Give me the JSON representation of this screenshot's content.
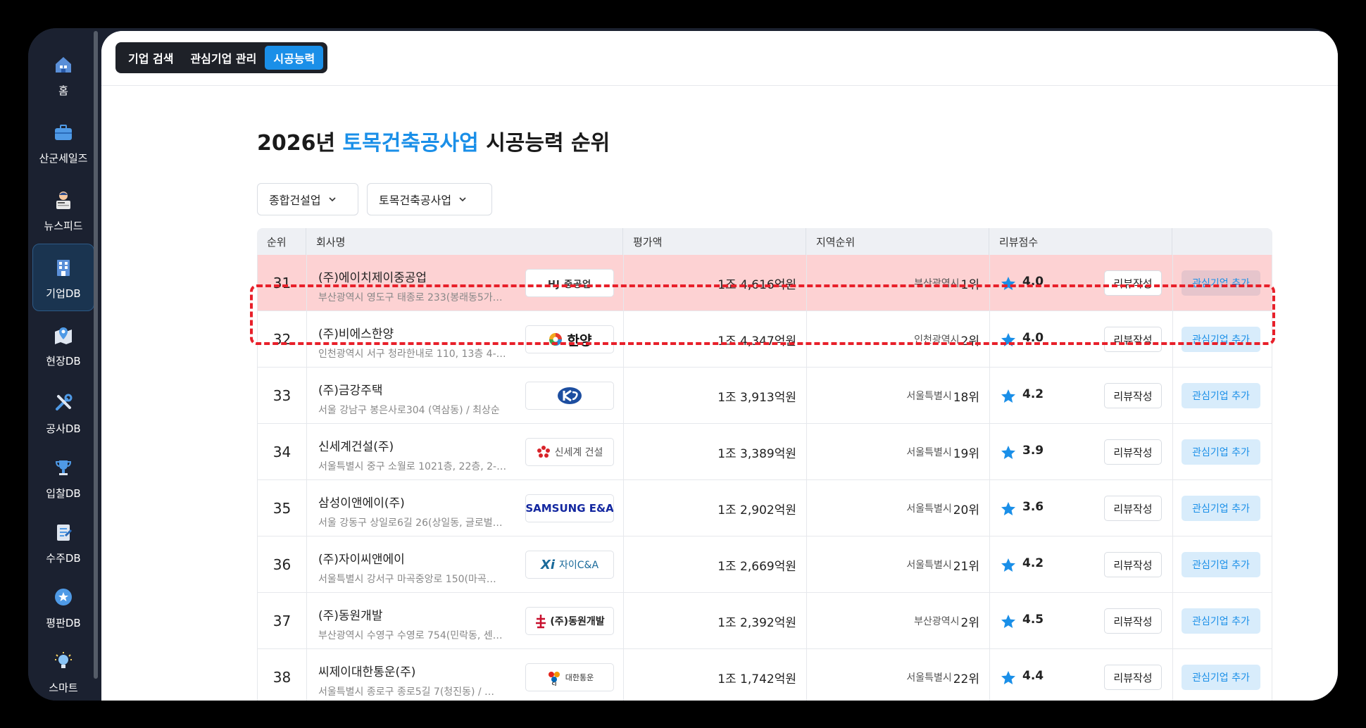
{
  "sidebar": {
    "items": [
      {
        "label": "홈",
        "icon": "home-icon"
      },
      {
        "label": "산군세일즈",
        "icon": "briefcase-icon"
      },
      {
        "label": "뉴스피드",
        "icon": "newspaper-reader-icon"
      },
      {
        "label": "기업DB",
        "icon": "building-icon"
      },
      {
        "label": "현장DB",
        "icon": "map-pin-icon"
      },
      {
        "label": "공사DB",
        "icon": "tools-icon"
      },
      {
        "label": "입찰DB",
        "icon": "trophy-icon"
      },
      {
        "label": "수주DB",
        "icon": "clipboard-icon"
      },
      {
        "label": "평판DB",
        "icon": "star-badge-icon"
      },
      {
        "label": "스마트",
        "icon": "lightbulb-icon"
      }
    ],
    "active_label": "기업DB"
  },
  "tabs": [
    {
      "label": "기업 검색"
    },
    {
      "label": "관심기업 관리"
    },
    {
      "label": "시공능력"
    }
  ],
  "page": {
    "title_prefix": "2026년 ",
    "title_highlight": "토목건축공사업",
    "title_suffix": " 시공능력 순위"
  },
  "filters": {
    "industry": "종합건설업",
    "category": "토목건축공사업"
  },
  "table": {
    "headers": [
      "순위",
      "회사명",
      "평가액",
      "지역순위",
      "리뷰점수",
      ""
    ],
    "review_button": "리뷰작성",
    "favorite_button": "관심기업 추가",
    "rows": [
      {
        "rank": "31",
        "name": "(주)에이치제이중공업",
        "address": "부산광역시 영도구 태종로 233(봉래동5가…",
        "logo": "HJ 중공업",
        "amount": "1조 4,616억원",
        "region": "부산광역시",
        "region_rank": "1위",
        "score": "4.0",
        "highlighted": true
      },
      {
        "rank": "32",
        "name": "(주)비에스한양",
        "address": "인천광역시 서구 청라한내로 110, 13층 4-…",
        "logo": "한양",
        "amount": "1조 4,347억원",
        "region": "인천광역시",
        "region_rank": "2위",
        "score": "4.0",
        "highlighted": false
      },
      {
        "rank": "33",
        "name": "(주)금강주택",
        "address": "서울 강남구 봉은사로304 (역삼동) / 최상순",
        "logo": "",
        "amount": "1조 3,913억원",
        "region": "서울특별시",
        "region_rank": "18위",
        "score": "4.2",
        "highlighted": false
      },
      {
        "rank": "34",
        "name": "신세계건설(주)",
        "address": "서울특별시 중구 소월로 1021층, 22층, 2-…",
        "logo": "신세계 건설",
        "amount": "1조 3,389억원",
        "region": "서울특별시",
        "region_rank": "19위",
        "score": "3.9",
        "highlighted": false
      },
      {
        "rank": "35",
        "name": "삼성이앤에이(주)",
        "address": "서울 강동구 상일로6길 26(상일동, 글로벌…",
        "logo": "SAMSUNG E&A",
        "amount": "1조 2,902억원",
        "region": "서울특별시",
        "region_rank": "20위",
        "score": "3.6",
        "highlighted": false
      },
      {
        "rank": "36",
        "name": "(주)자이씨앤에이",
        "address": "서울특별시 강서구 마곡중앙로 150(마곡…",
        "logo": "자이C&A",
        "amount": "1조 2,669억원",
        "region": "서울특별시",
        "region_rank": "21위",
        "score": "4.2",
        "highlighted": false
      },
      {
        "rank": "37",
        "name": "(주)동원개발",
        "address": "부산광역시 수영구 수영로 754(민락동, 센…",
        "logo": "(주)동원개발",
        "amount": "1조 2,392억원",
        "region": "부산광역시",
        "region_rank": "2위",
        "score": "4.5",
        "highlighted": false
      },
      {
        "rank": "38",
        "name": "씨제이대한통운(주)",
        "address": "서울특별시 종로구 종로5길 7(청진동) / …",
        "logo": "대한통운",
        "amount": "1조 1,742억원",
        "region": "서울특별시",
        "region_rank": "22위",
        "score": "4.4",
        "highlighted": false
      }
    ]
  },
  "colors": {
    "accent": "#1a8fe8",
    "highlight_row": "#fdd2d3",
    "highlight_border": "#e8202a",
    "sidebar_bg": "#1b2130",
    "star": "#1a8fe8"
  }
}
